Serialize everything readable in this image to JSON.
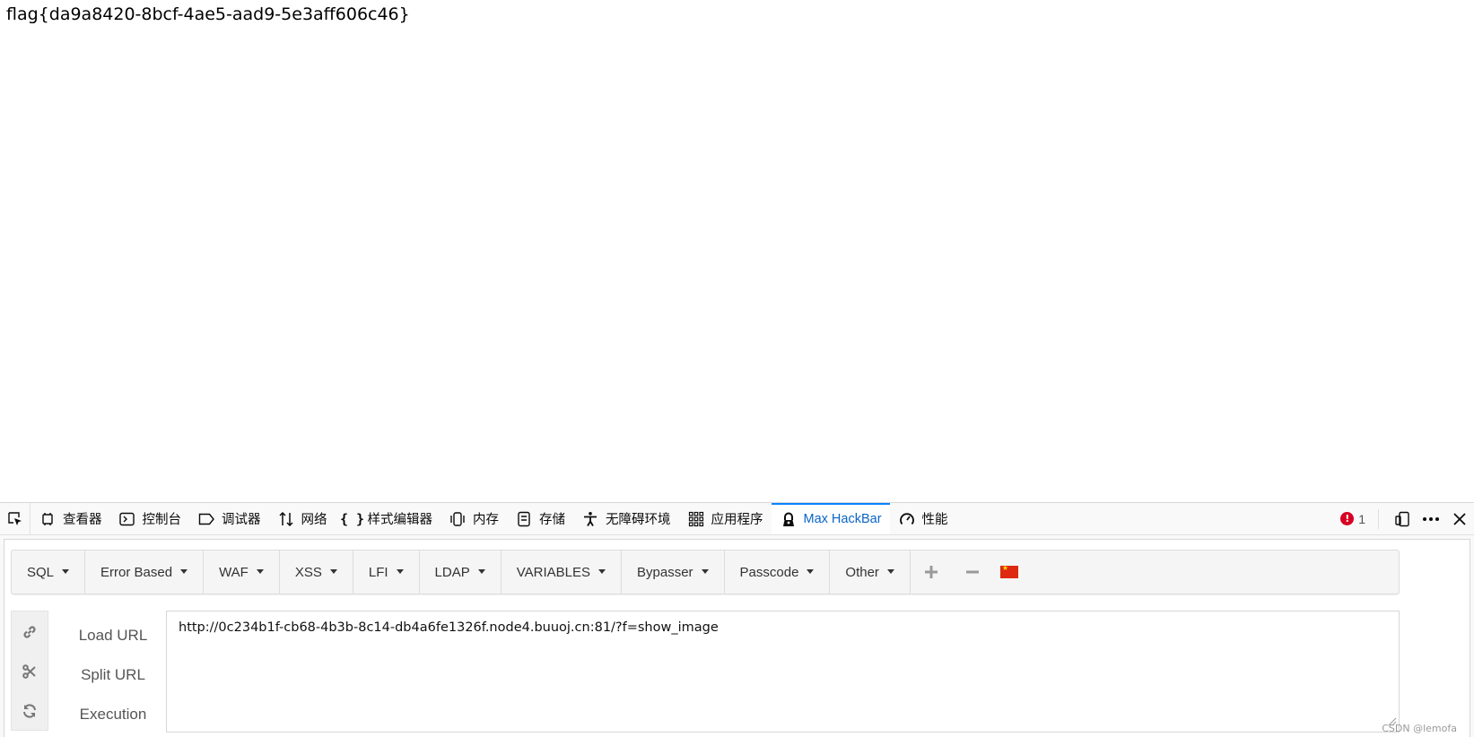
{
  "page": {
    "flag_text": "flag{da9a8420-8bcf-4ae5-aad9-5e3aff606c46}"
  },
  "devtools": {
    "tabs": [
      {
        "label": "查看器",
        "icon": "inspector-icon"
      },
      {
        "label": "控制台",
        "icon": "console-icon"
      },
      {
        "label": "调试器",
        "icon": "debugger-icon"
      },
      {
        "label": "网络",
        "icon": "network-icon"
      },
      {
        "label": "样式编辑器",
        "icon": "style-editor-icon"
      },
      {
        "label": "内存",
        "icon": "memory-icon"
      },
      {
        "label": "存储",
        "icon": "storage-icon"
      },
      {
        "label": "无障碍环境",
        "icon": "accessibility-icon"
      },
      {
        "label": "应用程序",
        "icon": "application-icon"
      },
      {
        "label": "Max HackBar",
        "icon": "hackbar-icon",
        "selected": true
      },
      {
        "label": "性能",
        "icon": "performance-icon"
      }
    ],
    "error_count": "1",
    "accent_color": "#0a84ff",
    "error_color": "#d70022"
  },
  "hackbar": {
    "menus": [
      {
        "label": "SQL"
      },
      {
        "label": "Error Based"
      },
      {
        "label": "WAF"
      },
      {
        "label": "XSS"
      },
      {
        "label": "LFI"
      },
      {
        "label": "LDAP"
      },
      {
        "label": "VARIABLES"
      },
      {
        "label": "Bypasser"
      },
      {
        "label": "Passcode"
      },
      {
        "label": "Other"
      }
    ],
    "actions": [
      {
        "label": "Load URL",
        "icon": "link-icon"
      },
      {
        "label": "Split URL",
        "icon": "scissors-icon"
      },
      {
        "label": "Execution",
        "icon": "refresh-icon"
      }
    ],
    "url_value": "http://0c234b1f-cb68-4b3b-8c14-db4a6fe1326f.node4.buuoj.cn:81/?f=show_image"
  },
  "watermark": "CSDN @lemofa"
}
